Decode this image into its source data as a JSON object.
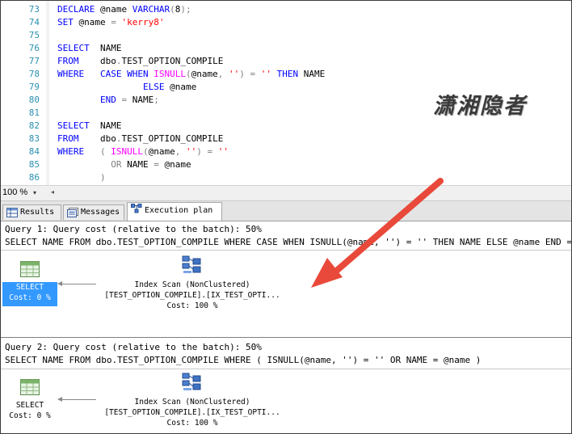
{
  "editor": {
    "lines": [
      {
        "n": "73",
        "tokens": [
          [
            "kw",
            "DECLARE "
          ],
          [
            "t",
            "@name "
          ],
          [
            "kw",
            "VARCHAR"
          ],
          [
            "op",
            "("
          ],
          [
            "t",
            "8"
          ],
          [
            "op",
            ");"
          ]
        ]
      },
      {
        "n": "74",
        "tokens": [
          [
            "kw",
            "SET "
          ],
          [
            "t",
            "@name "
          ],
          [
            "op",
            "= "
          ],
          [
            "str",
            "'kerry8'"
          ]
        ]
      },
      {
        "n": "75",
        "tokens": []
      },
      {
        "n": "76",
        "tokens": [
          [
            "kw",
            "SELECT  "
          ],
          [
            "t",
            "NAME"
          ]
        ]
      },
      {
        "n": "77",
        "tokens": [
          [
            "kw",
            "FROM    "
          ],
          [
            "t",
            "dbo"
          ],
          [
            "op",
            "."
          ],
          [
            "t",
            "TEST_OPTION_COMPILE"
          ]
        ]
      },
      {
        "n": "78",
        "tokens": [
          [
            "kw",
            "WHERE   CASE WHEN "
          ],
          [
            "fn",
            "ISNULL"
          ],
          [
            "op",
            "("
          ],
          [
            "t",
            "@name"
          ],
          [
            "op",
            ", "
          ],
          [
            "str",
            "''"
          ],
          [
            "op",
            ") = "
          ],
          [
            "str",
            "'' "
          ],
          [
            "kw",
            "THEN "
          ],
          [
            "t",
            "NAME"
          ]
        ]
      },
      {
        "n": "79",
        "tokens": [
          [
            "t",
            "                "
          ],
          [
            "kw",
            "ELSE "
          ],
          [
            "t",
            "@name"
          ]
        ]
      },
      {
        "n": "80",
        "tokens": [
          [
            "t",
            "        "
          ],
          [
            "kw",
            "END "
          ],
          [
            "op",
            "= "
          ],
          [
            "t",
            "NAME"
          ],
          [
            "op",
            ";"
          ]
        ]
      },
      {
        "n": "81",
        "tokens": []
      },
      {
        "n": "82",
        "tokens": [
          [
            "kw",
            "SELECT  "
          ],
          [
            "t",
            "NAME"
          ]
        ]
      },
      {
        "n": "83",
        "tokens": [
          [
            "kw",
            "FROM    "
          ],
          [
            "t",
            "dbo"
          ],
          [
            "op",
            "."
          ],
          [
            "t",
            "TEST_OPTION_COMPILE"
          ]
        ]
      },
      {
        "n": "84",
        "tokens": [
          [
            "kw",
            "WHERE   "
          ],
          [
            "op",
            "( "
          ],
          [
            "fn",
            "ISNULL"
          ],
          [
            "op",
            "("
          ],
          [
            "t",
            "@name"
          ],
          [
            "op",
            ", "
          ],
          [
            "str",
            "''"
          ],
          [
            "op",
            ") = "
          ],
          [
            "str",
            "''"
          ]
        ]
      },
      {
        "n": "85",
        "tokens": [
          [
            "t",
            "          "
          ],
          [
            "op",
            "OR "
          ],
          [
            "t",
            "NAME "
          ],
          [
            "op",
            "= "
          ],
          [
            "t",
            "@name"
          ]
        ]
      },
      {
        "n": "86",
        "tokens": [
          [
            "t",
            "        "
          ],
          [
            "op",
            ")"
          ]
        ]
      }
    ],
    "watermark": "潇湘隐者"
  },
  "zoom": {
    "value": "100 %"
  },
  "tabs": [
    {
      "label": "Results",
      "icon": "results-grid-icon"
    },
    {
      "label": "Messages",
      "icon": "messages-icon"
    },
    {
      "label": "Execution plan",
      "icon": "execution-plan-icon",
      "active": true
    }
  ],
  "queries": [
    {
      "header": "Query 1: Query cost (relative to the batch): 50%",
      "sql": "SELECT NAME FROM dbo.TEST_OPTION_COMPILE WHERE CASE WHEN ISNULL(@name, '') = '' THEN NAME ELSE @name END = NAME",
      "select": {
        "label": "SELECT",
        "cost": "Cost: 0 %",
        "highlighted": true
      },
      "scan": {
        "op": "Index Scan (NonClustered)",
        "object": "[TEST_OPTION_COMPILE].[IX_TEST_OPTI...",
        "cost": "Cost: 100 %"
      }
    },
    {
      "header": "Query 2: Query cost (relative to the batch): 50%",
      "sql": "SELECT NAME FROM dbo.TEST_OPTION_COMPILE WHERE ( ISNULL(@name, '') = '' OR NAME = @name )",
      "select": {
        "label": "SELECT",
        "cost": "Cost: 0 %",
        "highlighted": false
      },
      "scan": {
        "op": "Index Scan (NonClustered)",
        "object": "[TEST_OPTION_COMPILE].[IX_TEST_OPTI...",
        "cost": "Cost: 100 %"
      }
    }
  ],
  "colors": {
    "annotation_arrow": "#e8493a",
    "selection": "#3399ff",
    "keyword": "#0000ff",
    "function": "#ff00ff",
    "string": "#ff0000"
  }
}
